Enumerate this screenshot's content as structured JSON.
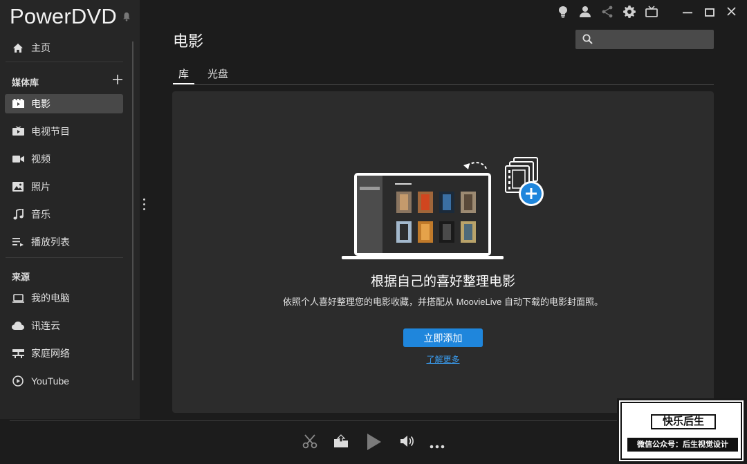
{
  "app": {
    "title": "PowerDVD"
  },
  "sidebar": {
    "home": "主页",
    "library_title": "媒体库",
    "library_items": [
      {
        "label": "电影",
        "icon": "movie-icon",
        "active": true
      },
      {
        "label": "电视节目",
        "icon": "tv-show-icon",
        "active": false
      },
      {
        "label": "视频",
        "icon": "video-icon",
        "active": false
      },
      {
        "label": "照片",
        "icon": "photo-icon",
        "active": false
      },
      {
        "label": "音乐",
        "icon": "music-icon",
        "active": false
      },
      {
        "label": "播放列表",
        "icon": "playlist-icon",
        "active": false
      }
    ],
    "sources_title": "来源",
    "source_items": [
      {
        "label": "我的电脑",
        "icon": "computer-icon"
      },
      {
        "label": "讯连云",
        "icon": "cloud-icon"
      },
      {
        "label": "家庭网络",
        "icon": "network-icon"
      },
      {
        "label": "YouTube",
        "icon": "youtube-icon"
      }
    ]
  },
  "main": {
    "title": "电影",
    "search": {
      "value": "",
      "placeholder": ""
    },
    "tabs": [
      "库",
      "光盘"
    ],
    "empty_state": {
      "headline": "根据自己的喜好整理电影",
      "description": "依照个人喜好整理您的电影收藏，并搭配从 MoovieLive 自动下载的电影封面照。",
      "add_button": "立即添加",
      "learn_more": "了解更多"
    }
  },
  "colors": {
    "accent": "#1f86dc",
    "link": "#3a9df0",
    "background": "#1c1c1c",
    "sidebar": "#262626",
    "panel": "#2c2c2c"
  },
  "watermark": {
    "title": "快乐后生",
    "subtitle": "微信公众号：后生视觉设计"
  }
}
